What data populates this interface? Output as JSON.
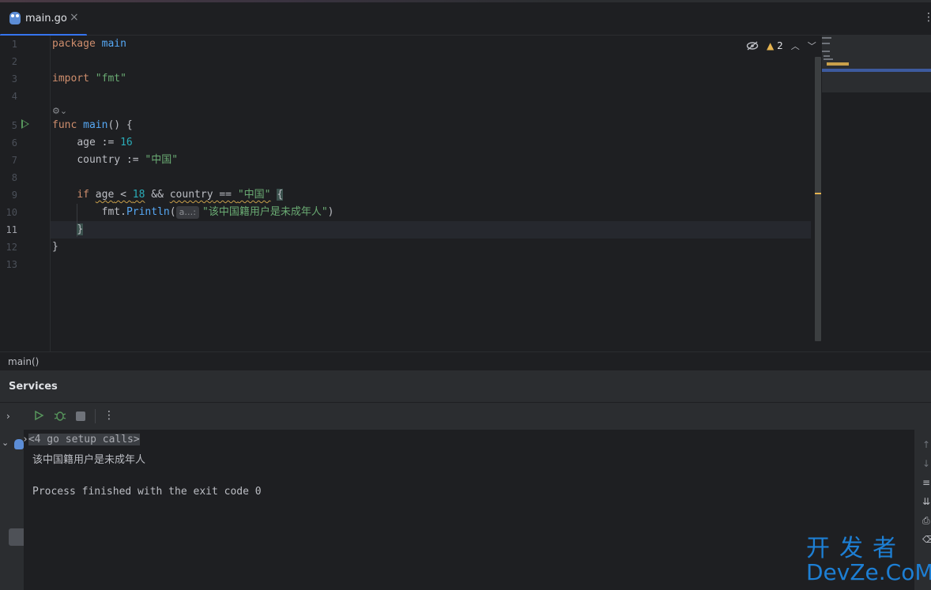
{
  "tab": {
    "filename": "main.go",
    "close": "×",
    "more": "⋮"
  },
  "editor": {
    "line_numbers": [
      "1",
      "2",
      "3",
      "4",
      "5",
      "6",
      "7",
      "8",
      "9",
      "10",
      "11",
      "12",
      "13"
    ],
    "active_line": "11",
    "codelens": "⚙⌄",
    "inspections": {
      "warnings": "2",
      "hide_icon": "eye-off-icon"
    },
    "lines": {
      "l1_kw": "package",
      "l1_id": "main",
      "l3_kw": "import",
      "l3_str": "\"fmt\"",
      "l5_kw": "func",
      "l5_fn": "main",
      "l5_rest": "() {",
      "l6_id": "age",
      "l6_op": " := ",
      "l6_num": "16",
      "l7_id": "country",
      "l7_op": " := ",
      "l7_str": "\"中国\"",
      "l9_kw": "if",
      "l9_a": "age",
      "l9_op1": " < ",
      "l9_num": "18",
      "l9_op2": " && ",
      "l9_b": "country",
      "l9_op3": " == ",
      "l9_str": "\"中国\"",
      "l9_brace": "{",
      "l10_obj": "fmt.",
      "l10_fn": "Println",
      "l10_paren": "(",
      "l10_hint": "a…:",
      "l10_str": "\"该中国籍用户是未成年人\"",
      "l10_close": ")",
      "l11_brace": "}",
      "l12_brace": "}"
    }
  },
  "breadcrumb": {
    "text": "main()"
  },
  "services": {
    "title": "Services",
    "console": {
      "line1": "<4 go setup calls>",
      "line2": "该中国籍用户是未成年人",
      "line3": "Process finished with the exit code 0"
    }
  },
  "watermark": {
    "top": "开发者",
    "bottom": "DevZe.CoM"
  },
  "colors": {
    "keyword": "#cf8e6d",
    "function": "#56a8f5",
    "string": "#6aab73",
    "number": "#2aacb8",
    "accent": "#3574f0",
    "run": "#57965c",
    "warning": "#e6b450"
  }
}
